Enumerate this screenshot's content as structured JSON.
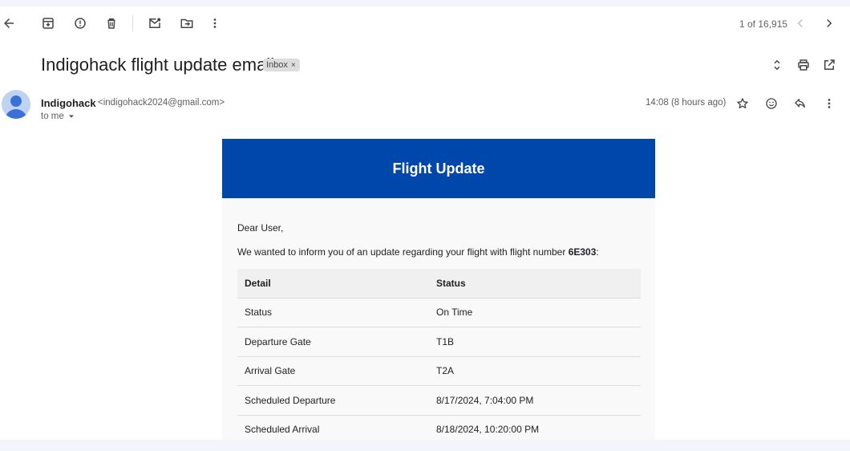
{
  "toolbar": {
    "back_icon": "arrow-left-icon",
    "archive_icon": "archive-icon",
    "spam_icon": "report-spam-icon",
    "delete_icon": "trash-icon",
    "mark_unread_icon": "mark-unread-icon",
    "move_icon": "move-to-folder-icon",
    "more_icon": "more-vertical-icon"
  },
  "pager": {
    "text": "1 of 16,915",
    "prev_icon": "chevron-left-icon",
    "next_icon": "chevron-right-icon"
  },
  "message": {
    "subject": "Indigohack flight update email",
    "label": "Inbox",
    "label_remove": "×",
    "sender_name": "Indigohack",
    "sender_email": "<indigohack2024@gmail.com>",
    "to_line": "to me",
    "timestamp": "14:08 (8 hours ago)"
  },
  "email": {
    "header_title": "Flight Update",
    "greeting": "Dear User,",
    "intro_prefix": "We wanted to inform you of an update regarding your flight with flight number ",
    "flight_number": "6E303",
    "intro_suffix": ":",
    "table": {
      "headers": [
        "Detail",
        "Status"
      ],
      "rows": [
        [
          "Status",
          "On Time"
        ],
        [
          "Departure Gate",
          "T1B"
        ],
        [
          "Arrival Gate",
          "T2A"
        ],
        [
          "Scheduled Departure",
          "8/17/2024, 7:04:00 PM"
        ],
        [
          "Scheduled Arrival",
          "8/18/2024, 10:20:00 PM"
        ]
      ]
    }
  },
  "colors": {
    "header_bg": "#0047ab",
    "card_bg": "#f9f9f9",
    "page_bg": "#ffffff"
  }
}
